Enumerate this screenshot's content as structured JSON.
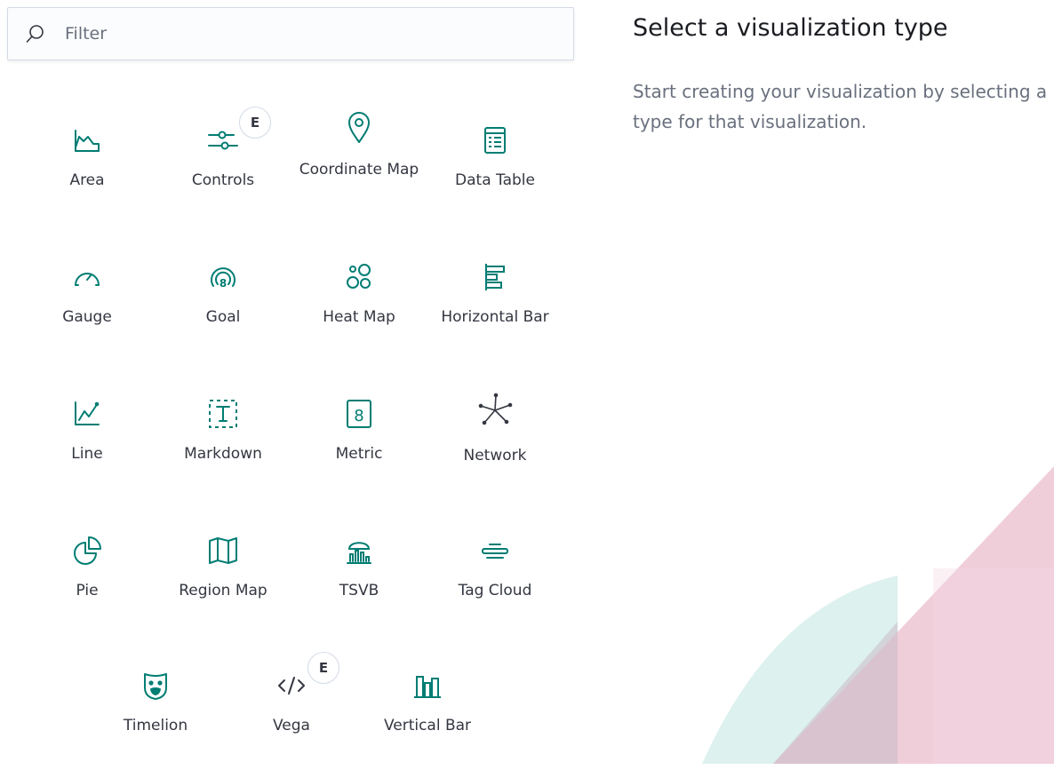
{
  "filter": {
    "placeholder": "Filter",
    "icon": "search-icon"
  },
  "visualizations": [
    {
      "label": "Area",
      "icon": "area-chart-icon",
      "badge": ""
    },
    {
      "label": "Controls",
      "icon": "controls-icon",
      "badge": "E"
    },
    {
      "label": "Coordinate Map",
      "icon": "map-pin-icon",
      "badge": ""
    },
    {
      "label": "Data Table",
      "icon": "table-icon",
      "badge": ""
    },
    {
      "label": "Gauge",
      "icon": "gauge-icon",
      "badge": ""
    },
    {
      "label": "Goal",
      "icon": "goal-icon",
      "badge": ""
    },
    {
      "label": "Heat Map",
      "icon": "heatmap-icon",
      "badge": ""
    },
    {
      "label": "Horizontal Bar",
      "icon": "horizontal-bar-icon",
      "badge": ""
    },
    {
      "label": "Line",
      "icon": "line-chart-icon",
      "badge": ""
    },
    {
      "label": "Markdown",
      "icon": "markdown-icon",
      "badge": ""
    },
    {
      "label": "Metric",
      "icon": "metric-icon",
      "badge": ""
    },
    {
      "label": "Network",
      "icon": "network-icon",
      "badge": ""
    },
    {
      "label": "Pie",
      "icon": "pie-chart-icon",
      "badge": ""
    },
    {
      "label": "Region Map",
      "icon": "region-map-icon",
      "badge": ""
    },
    {
      "label": "TSVB",
      "icon": "tsvb-icon",
      "badge": ""
    },
    {
      "label": "Tag Cloud",
      "icon": "tag-cloud-icon",
      "badge": ""
    },
    {
      "label": "Timelion",
      "icon": "timelion-icon",
      "badge": ""
    },
    {
      "label": "Vega",
      "icon": "code-icon",
      "badge": "E"
    },
    {
      "label": "Vertical Bar",
      "icon": "vertical-bar-icon",
      "badge": ""
    }
  ],
  "panel": {
    "title": "Select a visualization type",
    "description": "Start creating your visualization by selecting a type for that visualization."
  },
  "colors": {
    "accent": "#017d73",
    "text": "#343741",
    "muted": "#69707d",
    "decor_teal": "#d9efec",
    "decor_pink": "#ecc5d3"
  }
}
